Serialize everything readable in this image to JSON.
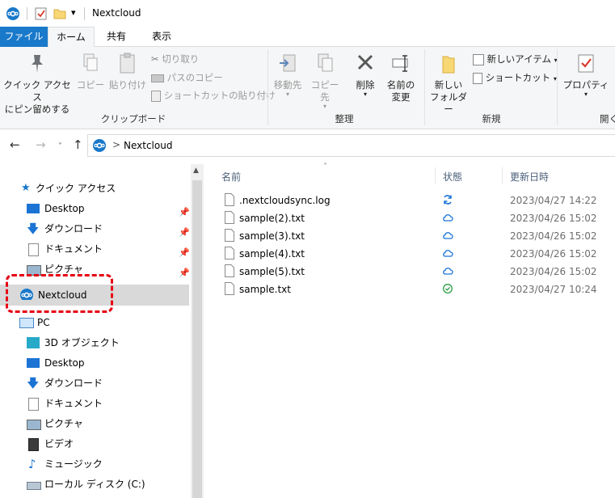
{
  "window": {
    "title": "Nextcloud"
  },
  "ribbon_tabs": [
    "ファイル",
    "ホーム",
    "共有",
    "表示"
  ],
  "ribbon": {
    "clipboard": {
      "group_label": "クリップボード",
      "pin_label_1": "クイック アクセス",
      "pin_label_2": "にピン留めする",
      "copy": "コピー",
      "paste": "貼り付け",
      "cut": "切り取り",
      "copy_path": "パスのコピー",
      "paste_shortcut": "ショートカットの貼り付け"
    },
    "organize": {
      "group_label": "整理",
      "move_to": "移動先",
      "copy_to": "コピー先",
      "delete": "削除",
      "rename_1": "名前の",
      "rename_2": "変更"
    },
    "new": {
      "group_label": "新規",
      "new_folder_1": "新しい",
      "new_folder_2": "フォルダー",
      "new_item": "新しいアイテム",
      "easy_access": "ショートカット"
    },
    "open": {
      "group_label": "開く",
      "properties": "プロパティ"
    }
  },
  "address": {
    "separator": ">",
    "location": "Nextcloud"
  },
  "nav": {
    "quick_access": "クイック アクセス",
    "quick_items": [
      "Desktop",
      "ダウンロード",
      "ドキュメント",
      "ピクチャ"
    ],
    "nextcloud": "Nextcloud",
    "pc": "PC",
    "pc_items": [
      "3D オブジェクト",
      "Desktop",
      "ダウンロード",
      "ドキュメント",
      "ピクチャ",
      "ビデオ",
      "ミュージック",
      "ローカル ディスク (C:)"
    ]
  },
  "columns": {
    "name": "名前",
    "status": "状態",
    "modified": "更新日時"
  },
  "files": [
    {
      "name": ".nextcloudsync.log",
      "status": "syncing",
      "modified": "2023/04/27 14:22"
    },
    {
      "name": "sample(2).txt",
      "status": "cloud",
      "modified": "2023/04/26 15:02"
    },
    {
      "name": "sample(3).txt",
      "status": "cloud",
      "modified": "2023/04/26 15:02"
    },
    {
      "name": "sample(4).txt",
      "status": "cloud",
      "modified": "2023/04/26 15:02"
    },
    {
      "name": "sample(5).txt",
      "status": "cloud",
      "modified": "2023/04/26 15:02"
    },
    {
      "name": "sample.txt",
      "status": "available",
      "modified": "2023/04/27 10:24"
    }
  ],
  "colors": {
    "accent": "#1979ca",
    "highlight": "#e60012",
    "sync_status": "#1a73d9",
    "ok_status": "#2e9e45"
  }
}
